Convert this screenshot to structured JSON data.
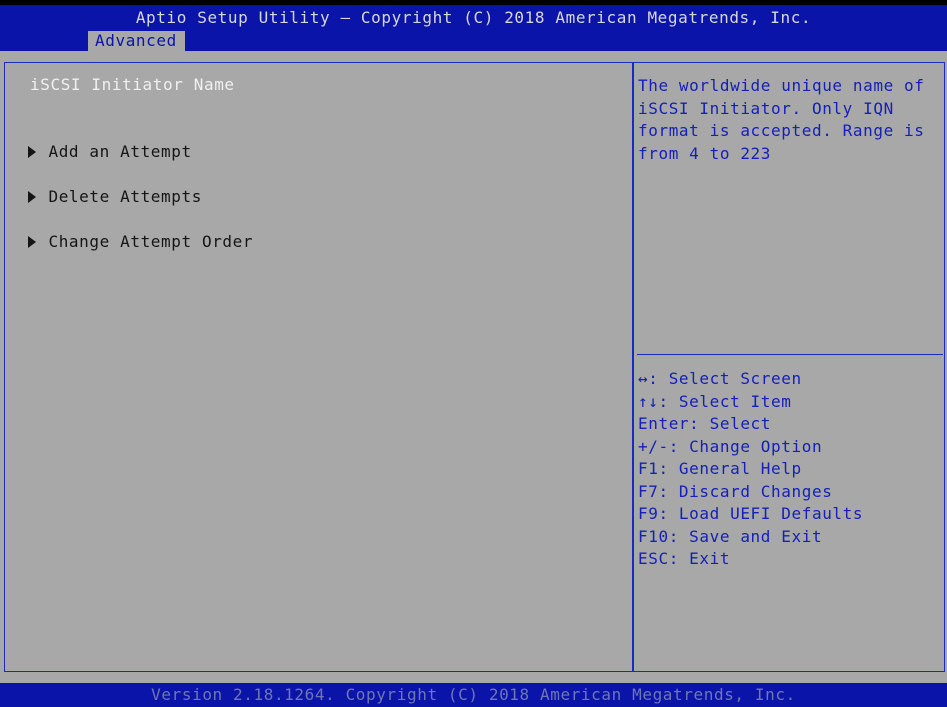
{
  "header": {
    "title": "Aptio Setup Utility – Copyright (C) 2018 American Megatrends, Inc.",
    "tabs": [
      {
        "label": "Advanced"
      }
    ]
  },
  "menu": {
    "label": "iSCSI Initiator Name",
    "items": [
      {
        "label": "Add an Attempt",
        "icon": "submenu-arrow-icon"
      },
      {
        "label": "Delete Attempts",
        "icon": "submenu-arrow-icon"
      },
      {
        "label": "Change Attempt Order",
        "icon": "submenu-arrow-icon"
      }
    ]
  },
  "help": {
    "text": "The worldwide unique name of iSCSI Initiator. Only IQN format is accepted. Range is from 4 to 223"
  },
  "keys": [
    "↔: Select Screen",
    "↑↓: Select Item",
    "Enter: Select",
    "+/-: Change Option",
    "F1: General Help",
    "F7: Discard Changes",
    "F9: Load UEFI Defaults",
    "F10: Save and Exit",
    "ESC: Exit"
  ],
  "footer": {
    "text": "Version 2.18.1264. Copyright (C) 2018 American Megatrends, Inc."
  },
  "colors": {
    "header_bg": "#0a14a8",
    "panel_bg": "#a8a8a8",
    "accent_text": "#1420b8",
    "selected_text": "#f0f0f0"
  }
}
